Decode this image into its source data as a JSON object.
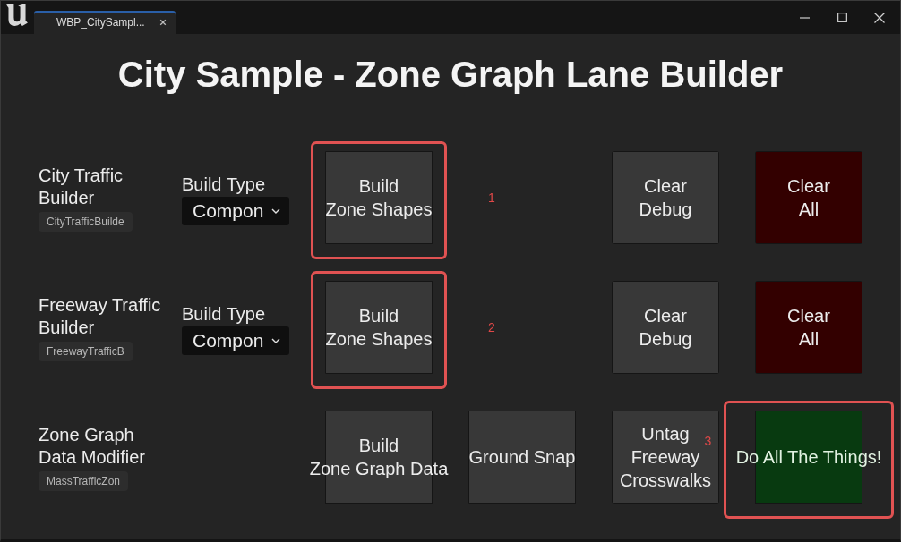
{
  "window": {
    "tab": {
      "title": "WBP_CitySampl...",
      "selected": true
    }
  },
  "heading": "City Sample - Zone Graph Lane Builder",
  "rows": [
    {
      "label": "City Traffic Builder",
      "asset": "CityTrafficBuilde",
      "build_type": {
        "label": "Build Type",
        "value": "Compon"
      },
      "column_3": {
        "label": "Build\nZone Shapes",
        "kind": "default",
        "annotation": "1"
      },
      "column_5": {
        "label": "Clear\nDebug",
        "kind": "default"
      },
      "column_6": {
        "label": "Clear\nAll",
        "kind": "danger"
      }
    },
    {
      "label": "Freeway Traffic Builder",
      "asset": "FreewayTrafficB",
      "build_type": {
        "label": "Build Type",
        "value": "Compon"
      },
      "column_3": {
        "label": "Build\nZone Shapes",
        "kind": "default",
        "annotation": "2"
      },
      "column_5": {
        "label": "Clear\nDebug",
        "kind": "default"
      },
      "column_6": {
        "label": "Clear\nAll",
        "kind": "danger"
      }
    },
    {
      "label": "Zone Graph Data Modifier",
      "asset": "MassTrafficZon",
      "column_3": {
        "label": "Build\nZone Graph Data",
        "kind": "default"
      },
      "column_4": {
        "label": "Ground Snap",
        "kind": "default"
      },
      "column_5": {
        "label": "Untag\nFreeway\nCrosswalks",
        "kind": "default"
      },
      "column_6": {
        "label": "Do All The Things!",
        "kind": "success",
        "annotation": "3"
      }
    }
  ]
}
